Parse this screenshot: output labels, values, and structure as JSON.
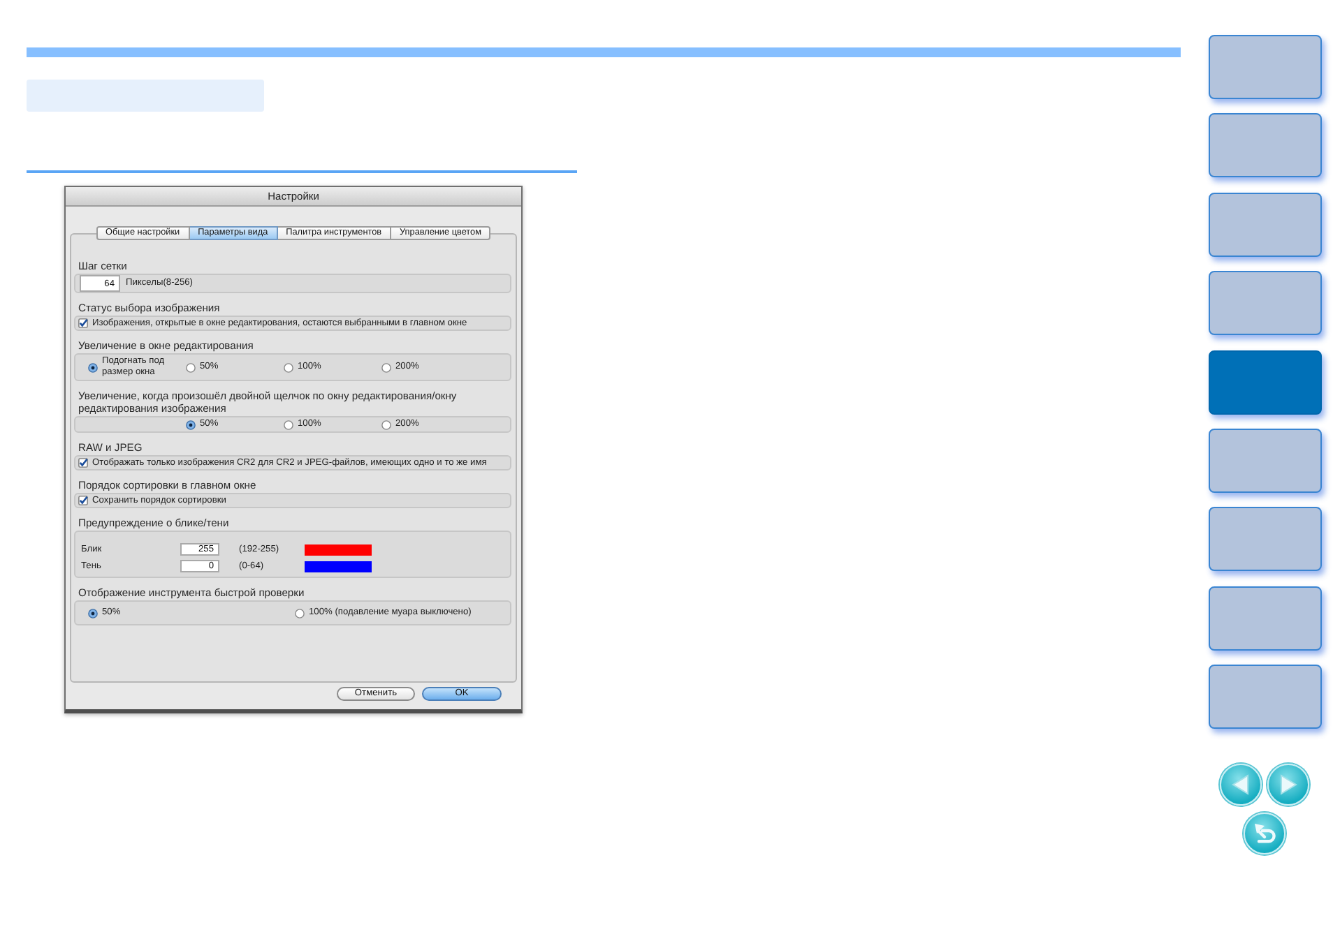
{
  "sidebar": {
    "items": [
      {
        "selected": false
      },
      {
        "selected": false
      },
      {
        "selected": false
      },
      {
        "selected": false
      },
      {
        "selected": true
      },
      {
        "selected": false
      },
      {
        "selected": false
      },
      {
        "selected": false
      },
      {
        "selected": false
      }
    ]
  },
  "dialog": {
    "title": "Настройки",
    "tabs": [
      {
        "label": "Общие настройки",
        "selected": false
      },
      {
        "label": "Параметры вида",
        "selected": true
      },
      {
        "label": "Палитра инструментов",
        "selected": false
      },
      {
        "label": "Управление цветом",
        "selected": false
      }
    ],
    "sections": [
      {
        "kind": "number",
        "title": "Шаг сетки",
        "value": "64",
        "hint": "Пикселы(8-256)"
      },
      {
        "kind": "checkbox",
        "title": "Статус выбора изображения",
        "label": "Изображения, открытые в окне редактирования, остаются выбранными в главном окне",
        "checked": true
      },
      {
        "kind": "radio",
        "title": "Увеличение в окне редактирования",
        "options": [
          {
            "label": "Подогнать под размер окна",
            "selected": true
          },
          {
            "label": "50%",
            "selected": false
          },
          {
            "label": "100%",
            "selected": false
          },
          {
            "label": "200%",
            "selected": false
          }
        ]
      },
      {
        "kind": "radio",
        "title": "Увеличение, когда произошёл двойной щелчок по окну редактирования/окну редактирования изображения",
        "options": [
          {
            "label": "50%",
            "selected": true
          },
          {
            "label": "100%",
            "selected": false
          },
          {
            "label": "200%",
            "selected": false
          }
        ]
      },
      {
        "kind": "checkbox",
        "title": "RAW и JPEG",
        "label": "Отображать только изображения CR2 для CR2 и JPEG-файлов, имеющих одно и то же имя",
        "checked": true
      },
      {
        "kind": "checkbox",
        "title": "Порядок сортировки в главном окне",
        "label": "Сохранить порядок сортировки",
        "checked": true
      },
      {
        "kind": "warning",
        "title": "Предупреждение о блике/тени",
        "rows": [
          {
            "label": "Блик",
            "value": "255",
            "range": "(192-255)",
            "color": "#ff0000"
          },
          {
            "label": "Тень",
            "value": "0",
            "range": "(0-64)",
            "color": "#0000ff"
          }
        ]
      },
      {
        "kind": "radio",
        "title": "Отображение инструмента быстрой проверки",
        "options": [
          {
            "label": "50%",
            "selected": true
          },
          {
            "label": "100% (подавление муара выключено)",
            "selected": false
          }
        ]
      }
    ],
    "buttons": [
      {
        "label": "Отменить",
        "kind": "cancel"
      },
      {
        "label": "OK",
        "kind": "ok"
      }
    ]
  }
}
